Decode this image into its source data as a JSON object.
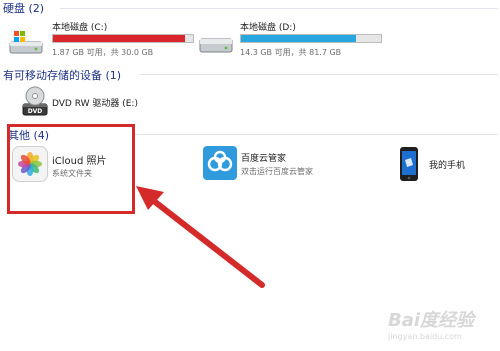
{
  "sections": {
    "hard_disks": {
      "title": "硬盘 (2)",
      "drives": [
        {
          "name": "本地磁盘 (C:)",
          "info": "1.87 GB 可用，共 30.0 GB",
          "used_fraction": 0.94,
          "bar_color": "#d9262b",
          "icon": "hard-drive-os-icon"
        },
        {
          "name": "本地磁盘 (D:)",
          "info": "14.3 GB 可用，共 81.7 GB",
          "used_fraction": 0.82,
          "bar_color": "#28a6e0",
          "icon": "hard-drive-icon"
        }
      ]
    },
    "removable": {
      "title": "有可移动存储的设备 (1)",
      "devices": [
        {
          "name": "DVD RW 驱动器 (E:)",
          "icon": "dvd-drive-icon"
        }
      ]
    },
    "other": {
      "title": "其他 (4)",
      "items": [
        {
          "name": "iCloud 照片",
          "sub": "系统文件夹",
          "icon": "icloud-photos-icon"
        },
        {
          "name": "百度云管家",
          "sub": "双击运行百度云管家",
          "icon": "baidu-cloud-icon"
        },
        {
          "name": "我的手机",
          "sub": "",
          "icon": "phone-icon"
        }
      ]
    }
  },
  "annotation": {
    "box_color": "#d52a2a",
    "arrow_color": "#d52a2a"
  },
  "watermark": {
    "text": "Bai度经验",
    "subtext": "jingyan.baidu.com"
  }
}
